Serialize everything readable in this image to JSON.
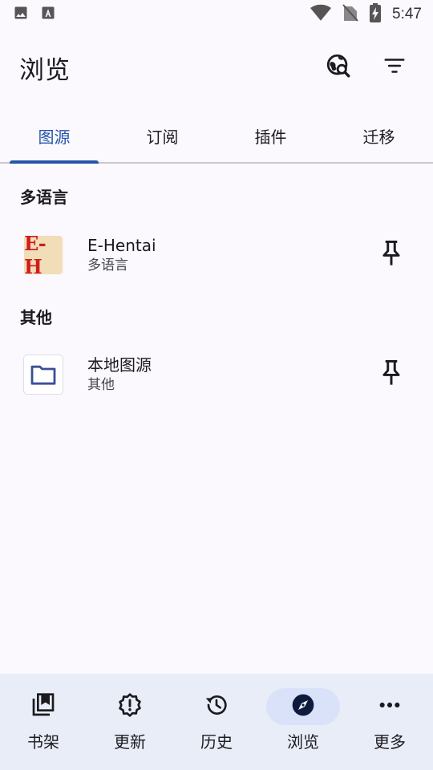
{
  "status_bar": {
    "time": "5:47",
    "icons": [
      "image-icon",
      "text-a-icon",
      "wifi-icon",
      "no-sim-icon",
      "battery-charging-icon"
    ]
  },
  "toolbar": {
    "title": "浏览",
    "actions": [
      "globe-search-icon",
      "filter-icon"
    ]
  },
  "tabs": [
    {
      "label": "图源",
      "active": true
    },
    {
      "label": "订阅",
      "active": false
    },
    {
      "label": "插件",
      "active": false
    },
    {
      "label": "迁移",
      "active": false
    }
  ],
  "sections": [
    {
      "header": "多语言",
      "items": [
        {
          "name": "E-Hentai",
          "subtitle": "多语言",
          "icon_text": "E-H",
          "icon": "ehentai-logo-icon",
          "pinned": true
        }
      ]
    },
    {
      "header": "其他",
      "items": [
        {
          "name": "本地图源",
          "subtitle": "其他",
          "icon": "folder-icon",
          "pinned": true
        }
      ]
    }
  ],
  "bottom_nav": [
    {
      "label": "书架",
      "icon": "library-icon",
      "active": false
    },
    {
      "label": "更新",
      "icon": "alert-badge-icon",
      "active": false
    },
    {
      "label": "历史",
      "icon": "history-icon",
      "active": false
    },
    {
      "label": "浏览",
      "icon": "compass-icon",
      "active": true
    },
    {
      "label": "更多",
      "icon": "more-icon",
      "active": false
    }
  ],
  "colors": {
    "accent": "#2555a8",
    "background": "#fbf8fe",
    "nav_background": "#e9edf7",
    "nav_active_pill": "#dae2fa"
  }
}
